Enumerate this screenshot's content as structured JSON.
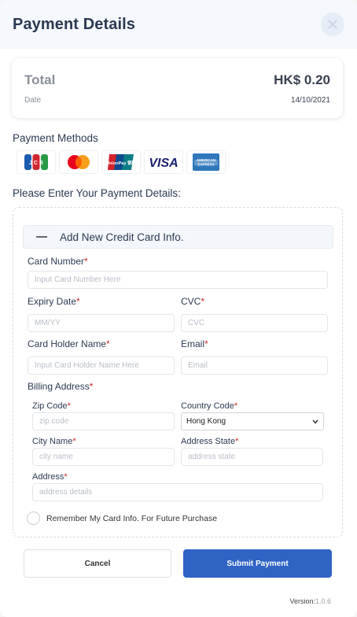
{
  "header": {
    "title": "Payment Details"
  },
  "summary": {
    "total_label": "Total",
    "total_value": "HK$ 0.20",
    "date_label": "Date",
    "date_value": "14/10/2021"
  },
  "payment_methods": {
    "title": "Payment Methods",
    "cards": [
      "jcb",
      "mastercard",
      "unionpay",
      "visa",
      "amex"
    ],
    "visa_text": "VISA",
    "amex_text": "AMERICAN EXPRESS",
    "unionpay_text": "UnionPay 银联"
  },
  "form": {
    "section_title": "Please Enter Your Payment Details:",
    "add_card_label": "Add New Credit Card Info.",
    "card_number": {
      "label": "Card Number",
      "placeholder": "Input Card Number Here"
    },
    "expiry": {
      "label": "Expiry Date",
      "placeholder": "MM/YY"
    },
    "cvc": {
      "label": "CVC",
      "placeholder": "CVC"
    },
    "holder": {
      "label": "Card Holder Name",
      "placeholder": "Input Card Holder Name Here"
    },
    "email": {
      "label": "Email",
      "placeholder": "Email"
    },
    "billing_label": "Billing Address",
    "zip": {
      "label": "Zip Code",
      "placeholder": "zip code"
    },
    "country": {
      "label": "Country Code",
      "value": "Hong Kong"
    },
    "city": {
      "label": "City Name",
      "placeholder": "city name"
    },
    "state": {
      "label": "Address State",
      "placeholder": "address state"
    },
    "address": {
      "label": "Address",
      "placeholder": "address details"
    },
    "remember_label": "Remember My Card Info. For Future Purchase",
    "required_mark": "*"
  },
  "actions": {
    "cancel": "Cancel",
    "submit": "Submit Payment"
  },
  "footer": {
    "version_label": "Version:",
    "version_number": "1.0.6"
  },
  "colors": {
    "primary": "#2f63c4",
    "required": "#c62828",
    "header_bg": "#f5f8fc"
  }
}
